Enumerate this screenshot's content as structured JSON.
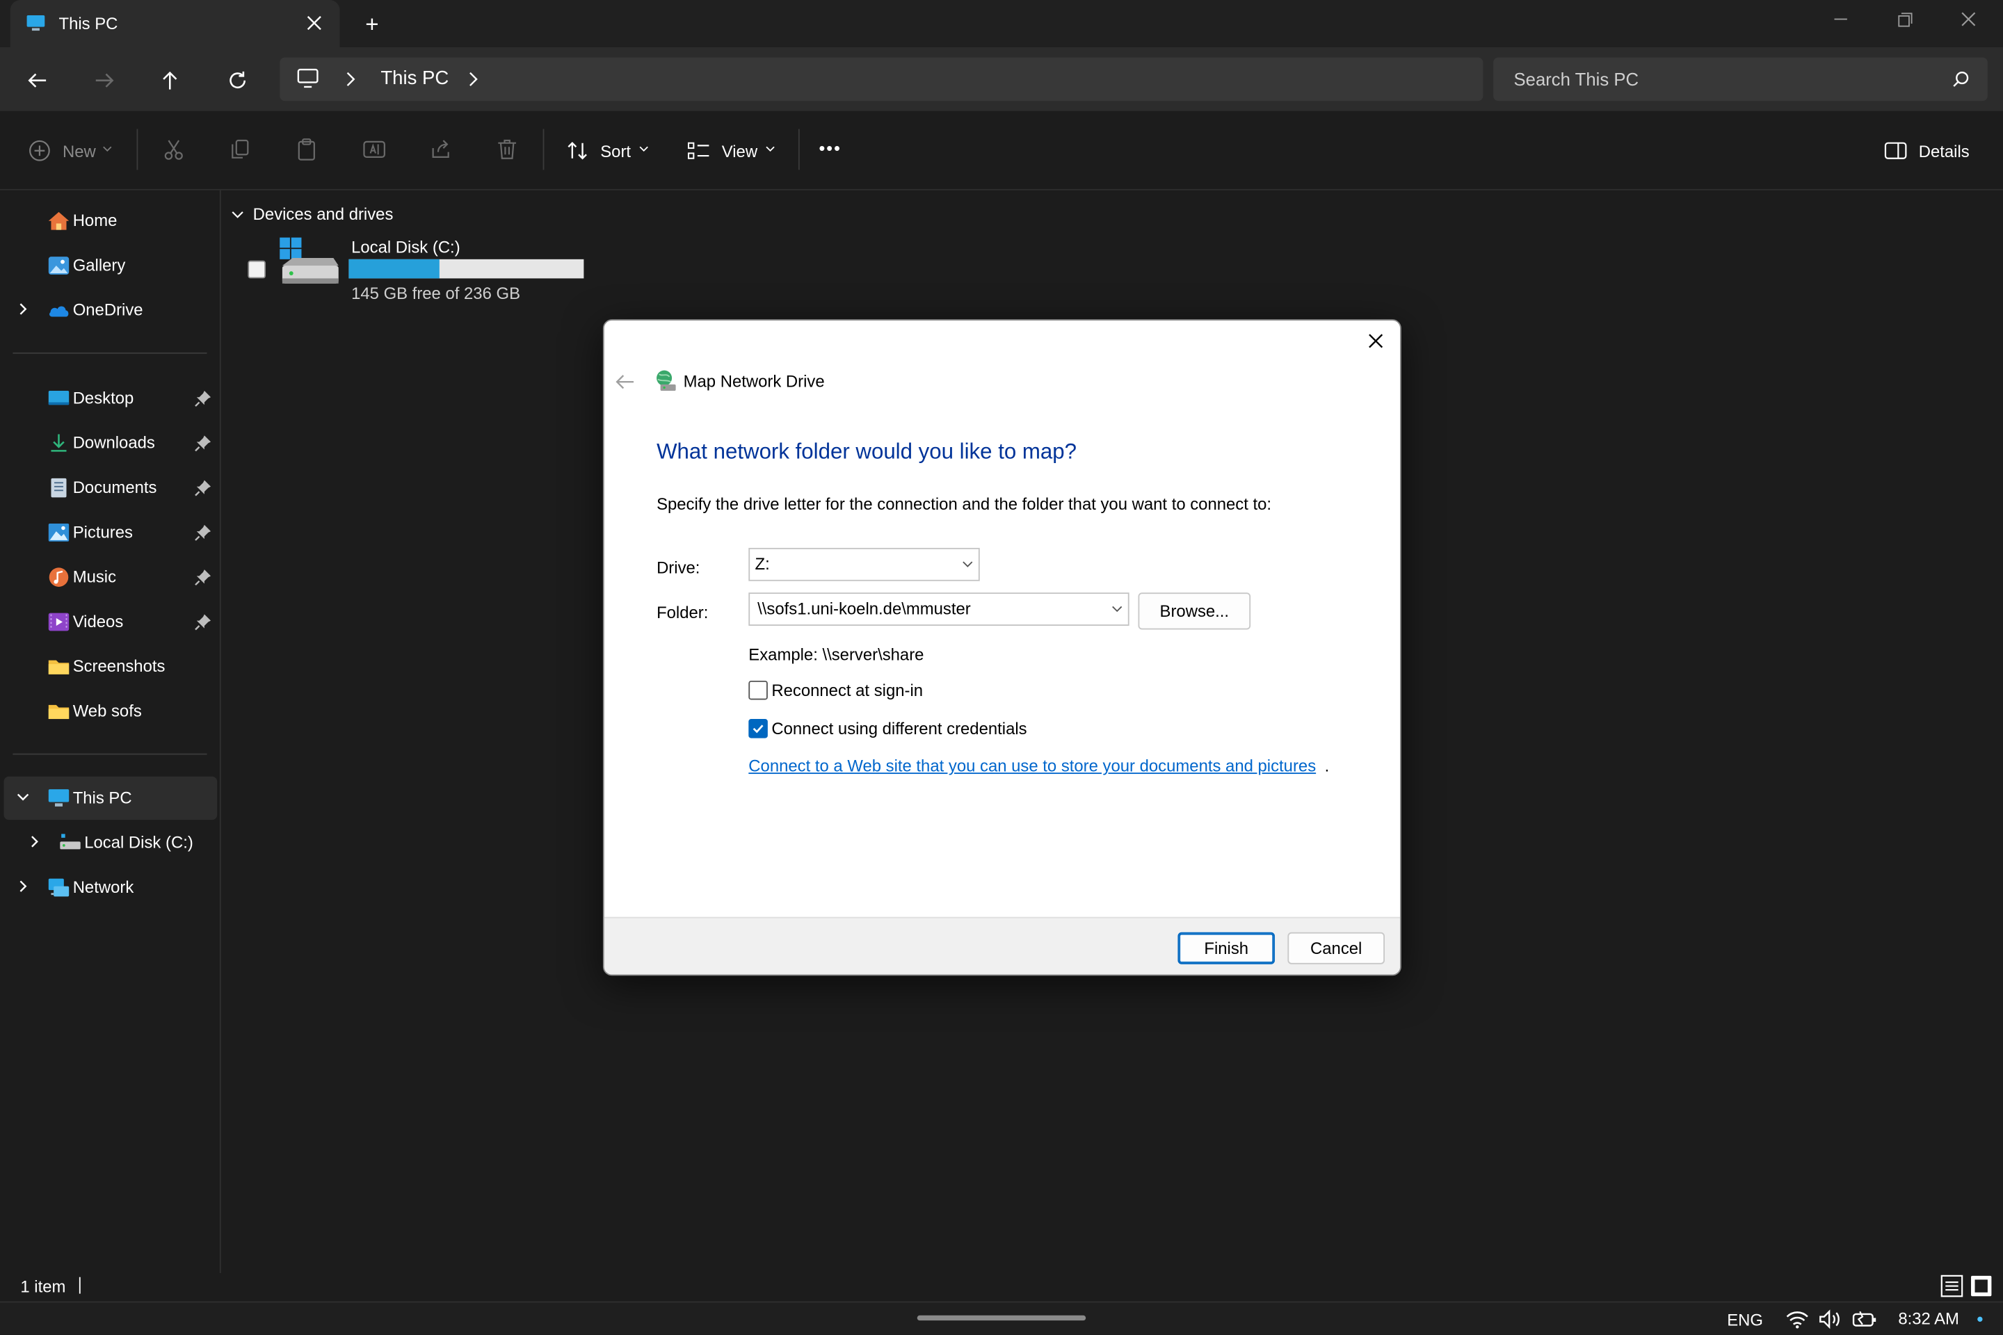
{
  "window": {
    "tab_title": "This PC",
    "new_tab": "+"
  },
  "nav": {
    "breadcrumb": [
      "This PC"
    ],
    "search_placeholder": "Search This PC"
  },
  "toolbar": {
    "new_label": "New",
    "sort_label": "Sort",
    "view_label": "View",
    "more_label": "•••",
    "details_label": "Details"
  },
  "sidebar": {
    "top_items": [
      {
        "label": "Home",
        "icon": "home-icon"
      },
      {
        "label": "Gallery",
        "icon": "gallery-icon"
      },
      {
        "label": "OneDrive",
        "icon": "cloud-icon"
      }
    ],
    "pinned_items": [
      {
        "label": "Desktop",
        "icon": "desktop-folder-icon"
      },
      {
        "label": "Downloads",
        "icon": "download-icon"
      },
      {
        "label": "Documents",
        "icon": "documents-icon"
      },
      {
        "label": "Pictures",
        "icon": "pictures-icon"
      },
      {
        "label": "Music",
        "icon": "music-icon"
      },
      {
        "label": "Videos",
        "icon": "videos-icon"
      },
      {
        "label": "Screenshots",
        "icon": "folder-icon"
      },
      {
        "label": "Web sofs",
        "icon": "folder-icon"
      }
    ],
    "bottom_items": [
      {
        "label": "This PC",
        "icon": "computer-icon"
      },
      {
        "label": "Local Disk (C:)",
        "icon": "drive-icon"
      },
      {
        "label": "Network",
        "icon": "network-icon"
      }
    ]
  },
  "content": {
    "group_header": "Devices and drives",
    "drive": {
      "name": "Local Disk (C:)",
      "free_text": "145 GB free of 236 GB",
      "used_fraction": 0.386
    }
  },
  "status": {
    "item_count": "1 item"
  },
  "taskbar": {
    "language": "ENG",
    "time": "8:32 AM"
  },
  "dialog": {
    "title": "Map Network Drive",
    "heading": "What network folder would you like to map?",
    "instruction": "Specify the drive letter for the connection and the folder that you want to connect to:",
    "drive_label": "Drive:",
    "drive_value": "Z:",
    "folder_label": "Folder:",
    "folder_value": "\\\\sofs1.uni-koeln.de\\mmuster",
    "browse_label": "Browse...",
    "example": "Example: \\\\server\\share",
    "reconnect_label": "Reconnect at sign-in",
    "reconnect_checked": false,
    "credentials_label": "Connect using different credentials",
    "credentials_checked": true,
    "link_text": "Connect to a Web site that you can use to store your documents and pictures",
    "link_suffix": ".",
    "finish_label": "Finish",
    "cancel_label": "Cancel"
  },
  "colors": {
    "accent": "#0067c0",
    "dialog_heading": "#003399",
    "link": "#0066cc",
    "storage_bar": "#26a0da"
  }
}
